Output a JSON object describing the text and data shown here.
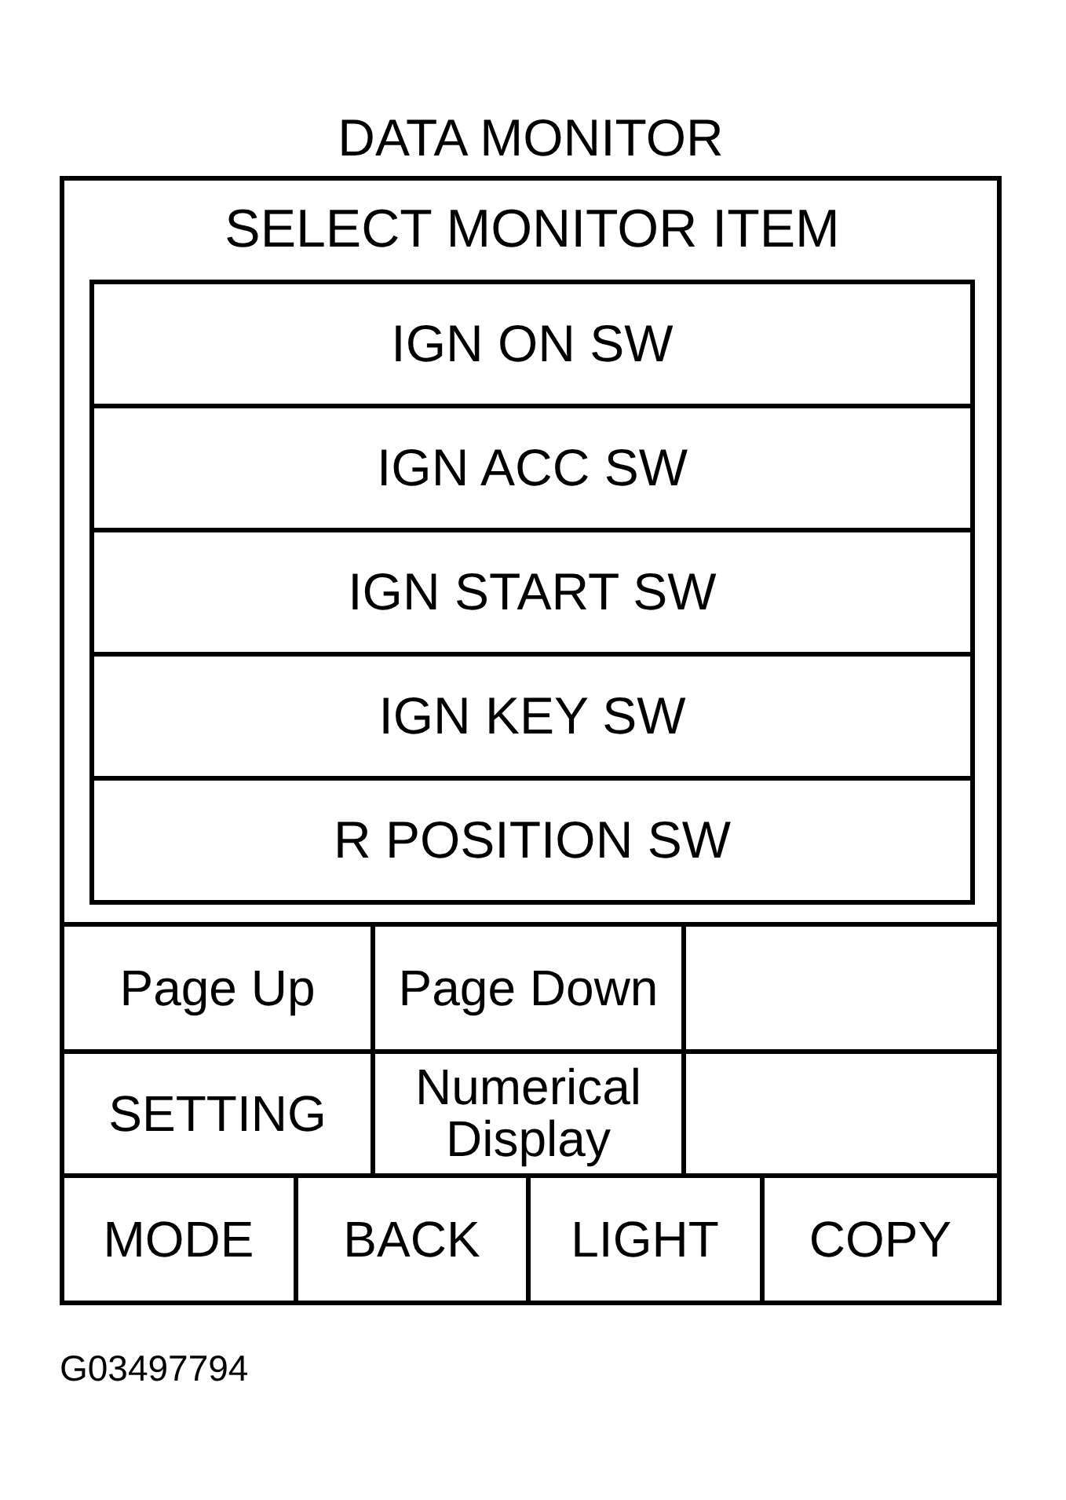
{
  "title": "DATA MONITOR",
  "panel": {
    "heading": "SELECT MONITOR ITEM",
    "items": [
      {
        "label": "IGN ON SW"
      },
      {
        "label": "IGN ACC SW"
      },
      {
        "label": "IGN START SW"
      },
      {
        "label": "IGN KEY SW"
      },
      {
        "label": "R POSITION SW"
      }
    ]
  },
  "key_rows": [
    {
      "keys": [
        {
          "kind": "key",
          "label": "Page Up"
        },
        {
          "kind": "key",
          "label": "Page Down"
        },
        {
          "kind": "blank"
        }
      ]
    },
    {
      "keys": [
        {
          "kind": "key",
          "label": "SETTING"
        },
        {
          "kind": "key",
          "label": "Numerical Display"
        },
        {
          "kind": "blank"
        }
      ]
    },
    {
      "keys": [
        {
          "kind": "key",
          "label": "MODE"
        },
        {
          "kind": "key",
          "label": "BACK"
        },
        {
          "kind": "key",
          "label": "LIGHT"
        },
        {
          "kind": "key",
          "label": "COPY"
        }
      ]
    }
  ],
  "figure_id": "G03497794"
}
